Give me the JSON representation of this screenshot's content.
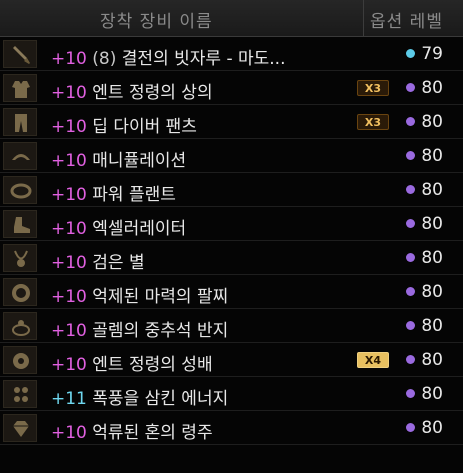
{
  "header": {
    "name_label": "장착 장비 이름",
    "level_label": "옵션 레벨"
  },
  "items": [
    {
      "icon": "sword-icon",
      "enhance": "+10",
      "sub": "(8)",
      "name": "결전의 빗자루 - 마도...",
      "badge": "",
      "level": "79",
      "dot_color": "#5ccbe8"
    },
    {
      "icon": "armor-top-icon",
      "enhance": "+10",
      "sub": "",
      "name": "엔트 정령의 상의",
      "badge": "X3",
      "level": "80",
      "dot_color": "#9a6ae0"
    },
    {
      "icon": "armor-pants-icon",
      "enhance": "+10",
      "sub": "",
      "name": "딥 다이버 팬츠",
      "badge": "X3",
      "level": "80",
      "dot_color": "#9a6ae0"
    },
    {
      "icon": "shoulder-icon",
      "enhance": "+10",
      "sub": "",
      "name": "매니퓰레이션",
      "badge": "",
      "level": "80",
      "dot_color": "#9a6ae0"
    },
    {
      "icon": "belt-icon",
      "enhance": "+10",
      "sub": "",
      "name": "파워 플랜트",
      "badge": "",
      "level": "80",
      "dot_color": "#9a6ae0"
    },
    {
      "icon": "shoes-icon",
      "enhance": "+10",
      "sub": "",
      "name": "엑셀러레이터",
      "badge": "",
      "level": "80",
      "dot_color": "#9a6ae0"
    },
    {
      "icon": "necklace-icon",
      "enhance": "+10",
      "sub": "",
      "name": "검은 별",
      "badge": "",
      "level": "80",
      "dot_color": "#9a6ae0"
    },
    {
      "icon": "bracelet-icon",
      "enhance": "+10",
      "sub": "",
      "name": "억제된 마력의 팔찌",
      "badge": "",
      "level": "80",
      "dot_color": "#9a6ae0"
    },
    {
      "icon": "ring-icon",
      "enhance": "+10",
      "sub": "",
      "name": "골렘의 중추석 반지",
      "badge": "",
      "level": "80",
      "dot_color": "#9a6ae0"
    },
    {
      "icon": "aux-equipment-icon",
      "enhance": "+10",
      "sub": "",
      "name": "엔트 정령의 성배",
      "badge": "X4",
      "level": "80",
      "dot_color": "#9a6ae0"
    },
    {
      "icon": "magic-stone-icon",
      "enhance": "+11",
      "sub": "",
      "name": "폭풍을 삼킨 에너지",
      "badge": "",
      "level": "80",
      "dot_color": "#9a6ae0"
    },
    {
      "icon": "earring-gem-icon",
      "enhance": "+10",
      "sub": "",
      "name": "억류된 혼의 령주",
      "badge": "",
      "level": "80",
      "dot_color": "#9a6ae0"
    }
  ]
}
